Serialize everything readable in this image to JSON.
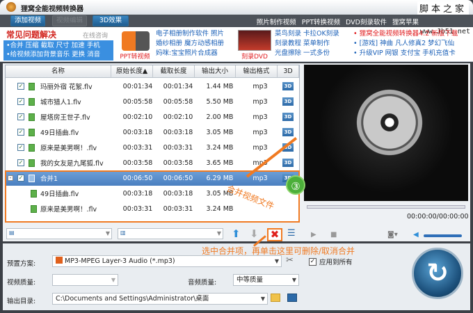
{
  "app": {
    "title": "狸窝全能视频转换器",
    "watermark": "脚本之家",
    "watermark_url": "www.Jb51.net"
  },
  "toolbar": {
    "add_video": "添加视频",
    "edit_video": "视频编辑",
    "effect_3d": "3D效果",
    "links": [
      "照片制作视频",
      "PPT转换视频",
      "DVD刻录软件",
      "狸窝苹果"
    ]
  },
  "ad": {
    "faq_title": "常见问题解决",
    "online": "在线咨询",
    "faq_line1": "•合并 压缩 截取 尺寸 加速 手机",
    "faq_line2": "•给视频添加背景音乐 更换 消音",
    "ppt_caption": "PPT转视频",
    "col2": [
      "电子相册制作软件 照片",
      "婚纱相册 魔方动感相册",
      "妈咪:宝宝照片合成器"
    ],
    "dvd_caption": "刻录DVD",
    "col3": [
      "菜鸟刻录 卡拉OK刻录",
      "刻录教程 菜单制作",
      "光盘擦除 一式多份"
    ],
    "col4": [
      "• 狸窝全能视频转换器4.2 新版下载",
      "• [游戏] 神曲 凡人修真2 梦幻飞仙",
      "• 升级VIP 网银 支付宝 手机充值卡"
    ]
  },
  "list": {
    "headers": [
      "名称",
      "原始长度▲",
      "截取长度",
      "输出大小",
      "输出格式",
      "3D"
    ],
    "rows": [
      {
        "name": "玛丽外宿 花絮.flv",
        "orig": "00:01:34",
        "cut": "00:01:34",
        "size": "1.44 MB",
        "fmt": "mp3"
      },
      {
        "name": "城市猎人1.flv",
        "orig": "00:05:58",
        "cut": "00:05:58",
        "size": "5.50 MB",
        "fmt": "mp3"
      },
      {
        "name": "屋塔房王世子.flv",
        "orig": "00:02:10",
        "cut": "00:02:10",
        "size": "2.00 MB",
        "fmt": "mp3"
      },
      {
        "name": "49日插曲.flv",
        "orig": "00:03:18",
        "cut": "00:03:18",
        "size": "3.05 MB",
        "fmt": "mp3"
      },
      {
        "name": "原来是美男啊！.flv",
        "orig": "00:03:31",
        "cut": "00:03:31",
        "size": "3.24 MB",
        "fmt": "mp3"
      },
      {
        "name": "我的女友是九尾狐.flv",
        "orig": "00:03:58",
        "cut": "00:03:58",
        "size": "3.65 MB",
        "fmt": "mp3"
      },
      {
        "name": "合并1",
        "orig": "00:06:50",
        "cut": "00:06:50",
        "size": "6.29 MB",
        "fmt": "mp3"
      },
      {
        "name": "49日插曲.flv",
        "orig": "00:03:18",
        "cut": "00:03:18",
        "size": "3.05 MB"
      },
      {
        "name": "原来是美男啊！.flv",
        "orig": "00:03:31",
        "cut": "00:03:31",
        "size": "3.24 MB"
      }
    ],
    "badge_3d": "3D"
  },
  "player": {
    "time": "00:00:00/00:00:00",
    "volume": 0.95,
    "progress": 0
  },
  "settings": {
    "preset_label": "预置方案:",
    "preset_value": "MP3-MPEG Layer-3 Audio (*.mp3)",
    "apply_all": "应用到所有",
    "video_quality_label": "视频质量:",
    "audio_quality_label": "音频质量:",
    "audio_quality_value": "中等质量",
    "output_label": "输出目录:",
    "output_value": "C:\\Documents and Settings\\Administrator\\桌面"
  },
  "annotations": {
    "merge": "合并视频文件",
    "step": "③",
    "delete_hint": "选中合并项，再单击这里可删除/取消合并"
  }
}
